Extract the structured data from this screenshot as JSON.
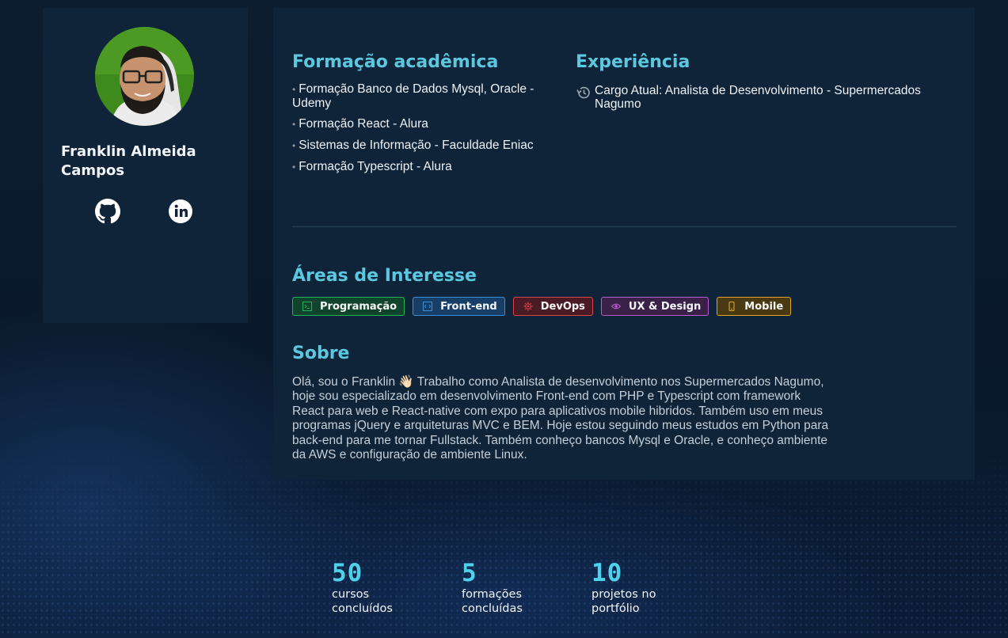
{
  "profile": {
    "name": "Franklin Almeida Campos"
  },
  "education": {
    "title": "Formação acadêmica",
    "items": [
      "Formação Banco de Dados Mysql, Oracle - Udemy",
      "Formação React - Alura",
      "Sistemas de Informação - Faculdade Eniac",
      "Formação Typescript - Alura"
    ]
  },
  "experience": {
    "title": "Experiência",
    "items": [
      "Cargo Atual: Analista de Desenvolvimento - Supermercados Nagumo"
    ]
  },
  "interests": {
    "title": "Áreas de Interesse",
    "tags": [
      {
        "label": "Programação",
        "icon": "terminal-icon",
        "color": "#22b35a"
      },
      {
        "label": "Front-end",
        "icon": "code-window-icon",
        "color": "#3a8fd6"
      },
      {
        "label": "DevOps",
        "icon": "gear-icon",
        "color": "#d9434c"
      },
      {
        "label": "UX & Design",
        "icon": "eye-icon",
        "color": "#b65ed0"
      },
      {
        "label": "Mobile",
        "icon": "smartphone-icon",
        "color": "#e0a428"
      }
    ]
  },
  "about": {
    "title": "Sobre",
    "text": "Olá, sou o Franklin 👋🏻 Trabalho como Analista de desenvolvimento nos Supermercados Nagumo, hoje sou especializado em desenvolvimento Front-end com PHP e Typescript com framework React para web e React-native com expo para aplicativos mobile hibridos. Também uso em meus programas jQuery e arquiteturas MVC e BEM. Hoje estou seguindo meus estudos em Python para back-end para me tornar Fullstack. Também conheço bancos Mysql e Oracle, e conheço ambiente da AWS e configuração de ambiente Linux."
  },
  "stats": [
    {
      "value": "50",
      "label": "cursos concluídos"
    },
    {
      "value": "5",
      "label": "formações concluídas"
    },
    {
      "value": "10",
      "label": "projetos no portfólio"
    }
  ],
  "colors": {
    "accent": "#5bc8e0",
    "stat_accent": "#4fd1ec",
    "card": "#0f2438",
    "background": "#0c1d30"
  }
}
